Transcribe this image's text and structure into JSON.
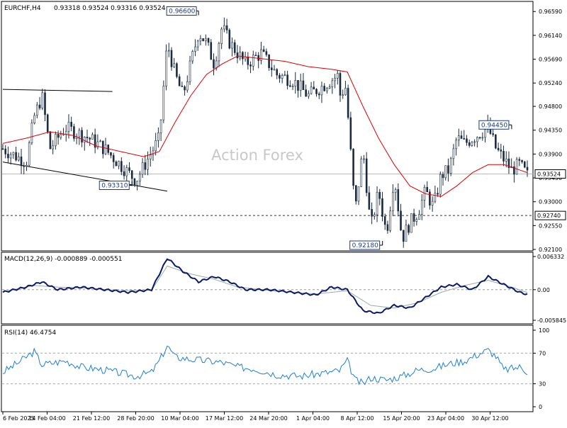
{
  "chart_data": {
    "type": "candlestick",
    "symbol": "EURCHF,H4",
    "ohlc_header": "0.93318 0.93524 0.93316 0.93524",
    "watermark": "Action Forex",
    "x_ticks": [
      "6 Feb 2025",
      "14 Feb 04:00",
      "21 Feb 12:00",
      "28 Feb 20:00",
      "10 Mar 04:00",
      "17 Mar 12:00",
      "24 Mar 20:00",
      "1 Apr 04:00",
      "8 Apr 12:00",
      "15 Apr 20:00",
      "23 Apr 04:00",
      "30 Apr 12:00"
    ],
    "price_panel": {
      "y_range": [
        0.921,
        0.967
      ],
      "y_ticks": [
        "0.96590",
        "0.96140",
        "0.95690",
        "0.95240",
        "0.94800",
        "0.94350",
        "0.93900",
        "0.93450",
        "0.93000",
        "0.92550",
        "0.92100"
      ],
      "current_price": 0.93524,
      "current_price_label": "0.93524",
      "support_level": 0.9274,
      "support_label": "0.92740",
      "annotations": [
        {
          "label": "0.96600",
          "x": 50,
          "y": 0.966
        },
        {
          "label": "0.93310",
          "x": 33,
          "y": 0.9331
        },
        {
          "label": "0.92180",
          "x": 97,
          "y": 0.9218
        },
        {
          "label": "0.94450",
          "x": 130,
          "y": 0.9445
        }
      ],
      "trendlines": [
        {
          "from": [
            0,
            0.9512
          ],
          "to": [
            28,
            0.9508
          ]
        },
        {
          "from": [
            0,
            0.9375
          ],
          "to": [
            42,
            0.932
          ]
        }
      ],
      "candles_n": 200,
      "close_path": [
        [
          0,
          0.94
        ],
        [
          6,
          0.9375
        ],
        [
          8,
          0.946
        ],
        [
          10,
          0.95
        ],
        [
          12,
          0.94
        ],
        [
          16,
          0.944
        ],
        [
          22,
          0.942
        ],
        [
          26,
          0.94
        ],
        [
          30,
          0.937
        ],
        [
          34,
          0.934
        ],
        [
          37,
          0.938
        ],
        [
          40,
          0.942
        ],
        [
          42,
          0.96
        ],
        [
          44,
          0.954
        ],
        [
          46,
          0.95
        ],
        [
          50,
          0.962
        ],
        [
          52,
          0.96
        ],
        [
          54,
          0.956
        ],
        [
          56,
          0.963
        ],
        [
          58,
          0.96
        ],
        [
          62,
          0.956
        ],
        [
          66,
          0.958
        ],
        [
          70,
          0.954
        ],
        [
          74,
          0.953
        ],
        [
          78,
          0.95
        ],
        [
          82,
          0.952
        ],
        [
          86,
          0.954
        ],
        [
          82,
          0.952
        ],
        [
          88,
          0.952
        ],
        [
          86,
          0.95
        ],
        [
          88,
          0.948
        ],
        [
          90,
          0.928
        ],
        [
          92,
          0.94
        ],
        [
          94,
          0.925
        ],
        [
          96,
          0.932
        ],
        [
          98,
          0.924
        ],
        [
          100,
          0.935
        ],
        [
          102,
          0.923
        ],
        [
          104,
          0.926
        ],
        [
          106,
          0.928
        ],
        [
          108,
          0.932
        ],
        [
          110,
          0.929
        ],
        [
          112,
          0.935
        ],
        [
          114,
          0.936
        ],
        [
          116,
          0.942
        ],
        [
          118,
          0.941
        ],
        [
          120,
          0.942
        ],
        [
          124,
          0.944
        ],
        [
          126,
          0.94
        ],
        [
          128,
          0.938
        ],
        [
          130,
          0.936
        ],
        [
          132,
          0.937
        ],
        [
          134,
          0.935
        ]
      ],
      "ma_path": [
        [
          0,
          0.941
        ],
        [
          6,
          0.942
        ],
        [
          12,
          0.9432
        ],
        [
          18,
          0.9425
        ],
        [
          24,
          0.9405
        ],
        [
          30,
          0.9395
        ],
        [
          36,
          0.9385
        ],
        [
          40,
          0.9395
        ],
        [
          44,
          0.945
        ],
        [
          48,
          0.95
        ],
        [
          52,
          0.954
        ],
        [
          56,
          0.956
        ],
        [
          60,
          0.9575
        ],
        [
          66,
          0.957
        ],
        [
          72,
          0.9565
        ],
        [
          78,
          0.9555
        ],
        [
          84,
          0.955
        ],
        [
          88,
          0.9545
        ],
        [
          92,
          0.948
        ],
        [
          96,
          0.942
        ],
        [
          100,
          0.937
        ],
        [
          104,
          0.933
        ],
        [
          108,
          0.9315
        ],
        [
          112,
          0.931
        ],
        [
          116,
          0.933
        ],
        [
          120,
          0.9355
        ],
        [
          124,
          0.937
        ],
        [
          128,
          0.937
        ],
        [
          132,
          0.936
        ],
        [
          134,
          0.9355
        ]
      ]
    },
    "macd_panel": {
      "label": "MACD(12,26,9) -0.000889 -0.000551",
      "y_range": [
        -0.005845,
        0.006332
      ],
      "y_ticks": [
        "0.006332",
        "0.00",
        "-0.005845"
      ],
      "macd_path": [
        [
          0,
          -0.0005
        ],
        [
          6,
          0.0005
        ],
        [
          10,
          0.0015
        ],
        [
          14,
          0.0
        ],
        [
          20,
          0.0005
        ],
        [
          26,
          0.0
        ],
        [
          32,
          -0.0005
        ],
        [
          38,
          0.0
        ],
        [
          42,
          0.006
        ],
        [
          46,
          0.0035
        ],
        [
          50,
          0.0015
        ],
        [
          54,
          0.0025
        ],
        [
          58,
          0.0015
        ],
        [
          62,
          0.0
        ],
        [
          68,
          0.0
        ],
        [
          74,
          -0.0005
        ],
        [
          80,
          -0.001
        ],
        [
          84,
          0.0005
        ],
        [
          88,
          0.0
        ],
        [
          92,
          -0.004
        ],
        [
          96,
          -0.0045
        ],
        [
          100,
          -0.003
        ],
        [
          104,
          -0.0035
        ],
        [
          108,
          -0.0015
        ],
        [
          112,
          0.0005
        ],
        [
          116,
          0.001
        ],
        [
          120,
          0.0
        ],
        [
          124,
          0.0025
        ],
        [
          128,
          0.001
        ],
        [
          132,
          -0.0005
        ],
        [
          134,
          -0.0009
        ]
      ],
      "signal_path": [
        [
          0,
          -0.0004
        ],
        [
          8,
          0.0008
        ],
        [
          14,
          0.0005
        ],
        [
          22,
          0.0003
        ],
        [
          30,
          -0.0002
        ],
        [
          38,
          -0.0001
        ],
        [
          42,
          0.0045
        ],
        [
          48,
          0.003
        ],
        [
          54,
          0.002
        ],
        [
          60,
          0.0005
        ],
        [
          70,
          -0.0003
        ],
        [
          80,
          -0.0008
        ],
        [
          88,
          -0.0002
        ],
        [
          94,
          -0.003
        ],
        [
          100,
          -0.0035
        ],
        [
          106,
          -0.0025
        ],
        [
          112,
          -0.0005
        ],
        [
          118,
          0.0008
        ],
        [
          124,
          0.0018
        ],
        [
          130,
          0.0005
        ],
        [
          134,
          -0.00055
        ]
      ]
    },
    "rsi_panel": {
      "label": "RSI(14) 46.4754",
      "y_range": [
        0,
        100
      ],
      "y_ticks": [
        "100",
        "70",
        "30",
        "0"
      ],
      "rsi_path": [
        [
          0,
          45
        ],
        [
          4,
          58
        ],
        [
          8,
          72
        ],
        [
          10,
          55
        ],
        [
          16,
          60
        ],
        [
          20,
          52
        ],
        [
          26,
          48
        ],
        [
          30,
          44
        ],
        [
          34,
          40
        ],
        [
          38,
          45
        ],
        [
          40,
          60
        ],
        [
          42,
          80
        ],
        [
          44,
          65
        ],
        [
          48,
          62
        ],
        [
          52,
          60
        ],
        [
          56,
          58
        ],
        [
          60,
          52
        ],
        [
          64,
          50
        ],
        [
          70,
          42
        ],
        [
          76,
          40
        ],
        [
          82,
          44
        ],
        [
          86,
          47
        ],
        [
          88,
          60
        ],
        [
          90,
          35
        ],
        [
          92,
          30
        ],
        [
          94,
          38
        ],
        [
          98,
          35
        ],
        [
          102,
          40
        ],
        [
          106,
          48
        ],
        [
          110,
          50
        ],
        [
          114,
          56
        ],
        [
          118,
          60
        ],
        [
          122,
          70
        ],
        [
          124,
          74
        ],
        [
          126,
          66
        ],
        [
          128,
          48
        ],
        [
          132,
          52
        ],
        [
          134,
          46
        ]
      ]
    }
  }
}
